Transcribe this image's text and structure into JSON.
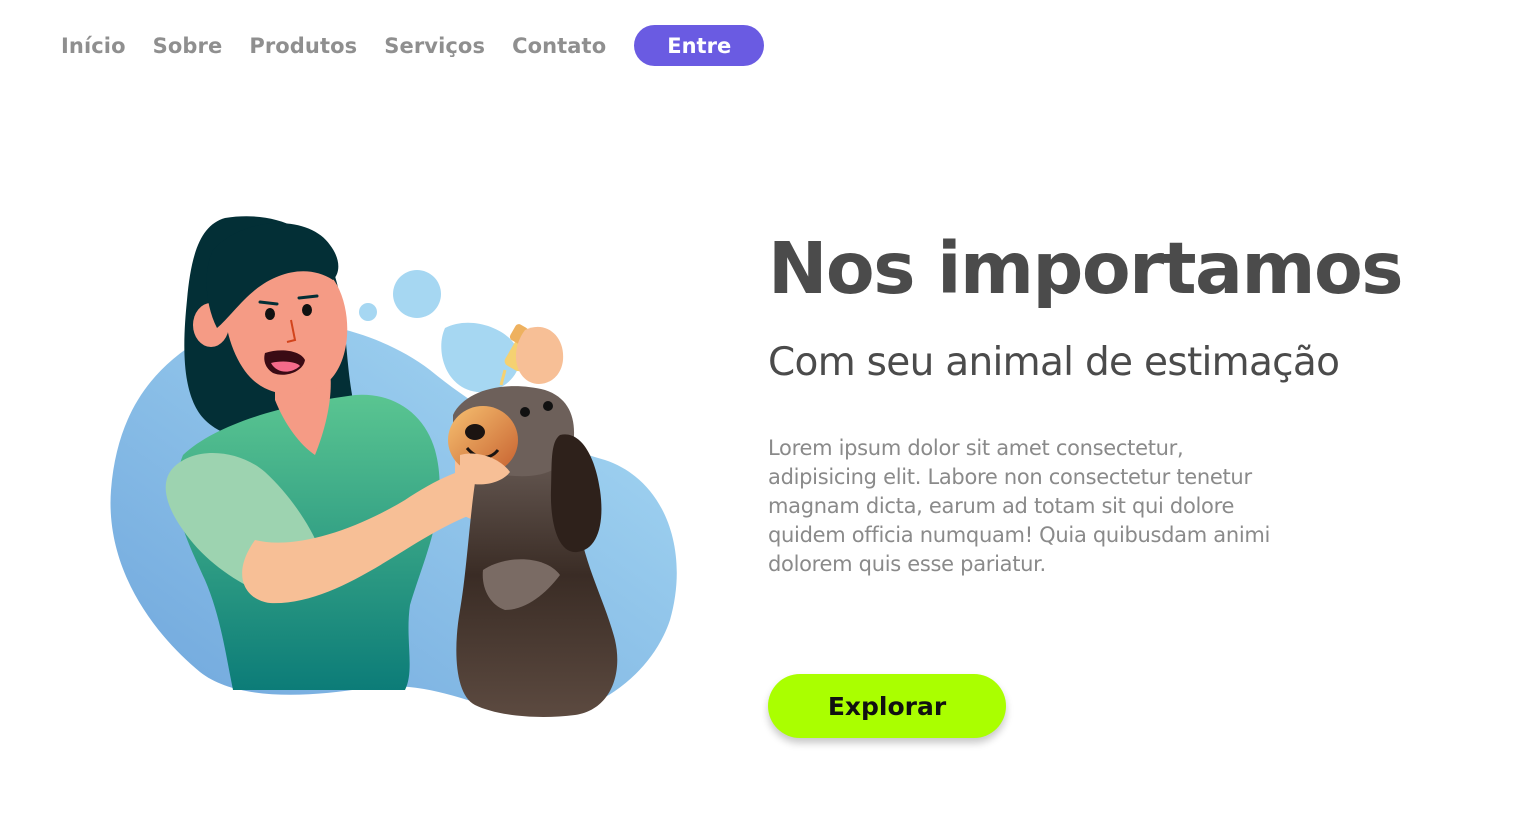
{
  "nav": {
    "links": [
      "Início",
      "Sobre",
      "Produtos",
      "Serviços",
      "Contato"
    ],
    "login_label": "Entre"
  },
  "hero": {
    "title": "Nos importamos",
    "subtitle": "Com seu animal de estimação",
    "description": "Lorem ipsum dolor sit amet consectetur, adipisicing elit. Labore non consectetur tenetur magnam dicta, earum ad totam sit qui dolore quidem officia numquam! Quia quibusdam animi dolorem quis esse pariatur.",
    "cta_label": "Explorar",
    "illustration": "woman-giving-eye-drops-to-dog-illustration"
  },
  "colors": {
    "nav_link": "#8f8f8f",
    "login_button": "#6a5be2",
    "cta_button": "#aaff00",
    "heading": "#4b4b4b",
    "body_text": "#8a8a8a"
  }
}
